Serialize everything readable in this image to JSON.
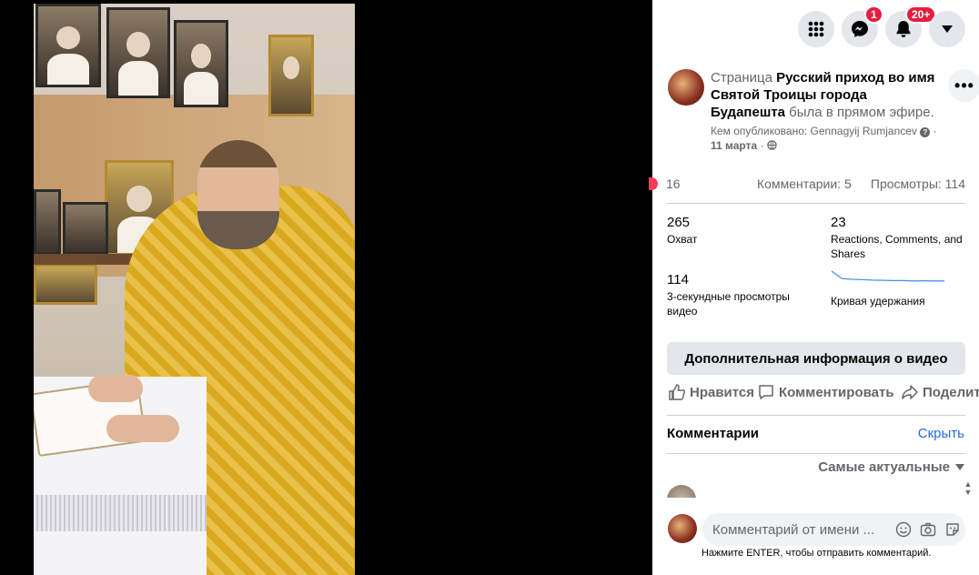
{
  "topbar": {
    "messenger_badge": "1",
    "notifications_badge": "20+"
  },
  "post": {
    "prefix": "Страница ",
    "page_name": "Русский приход во имя Святой Троицы города Будапешта",
    "suffix": " была в прямом эфире.",
    "published_by": "Кем опубликовано: Gennagyij Rumjancev",
    "date": "11 марта",
    "sep": "·"
  },
  "stats": {
    "reactions": "16",
    "comments": "Комментарии: 5",
    "views": "Просмотры: 114"
  },
  "insights": {
    "reach_value": "265",
    "reach_label": "Охват",
    "engagement_value": "23",
    "engagement_label": "Reactions, Comments, and Shares",
    "views3s_value": "114",
    "views3s_label": "3-секундные просмотры видео",
    "retention_label": "Кривая удержания",
    "retention_curve": [
      1.0,
      0.55,
      0.5,
      0.48,
      0.45,
      0.44,
      0.42,
      0.42,
      0.4,
      0.41,
      0.4,
      0.4
    ]
  },
  "more_info_button": "Дополнительная информация о видео",
  "actions": {
    "like": "Нравится",
    "comment": "Комментировать",
    "share": "Поделиться"
  },
  "comments": {
    "title": "Комментарии",
    "hide": "Скрыть",
    "sort": "Самые актуальные"
  },
  "composer": {
    "placeholder": "Комментарий от имени ...",
    "hint": "Нажмите ENTER, чтобы отправить комментарий."
  },
  "colors": {
    "accent": "#216fdb",
    "badge": "#e41e3f",
    "chart_line": "#4a8fe7"
  }
}
